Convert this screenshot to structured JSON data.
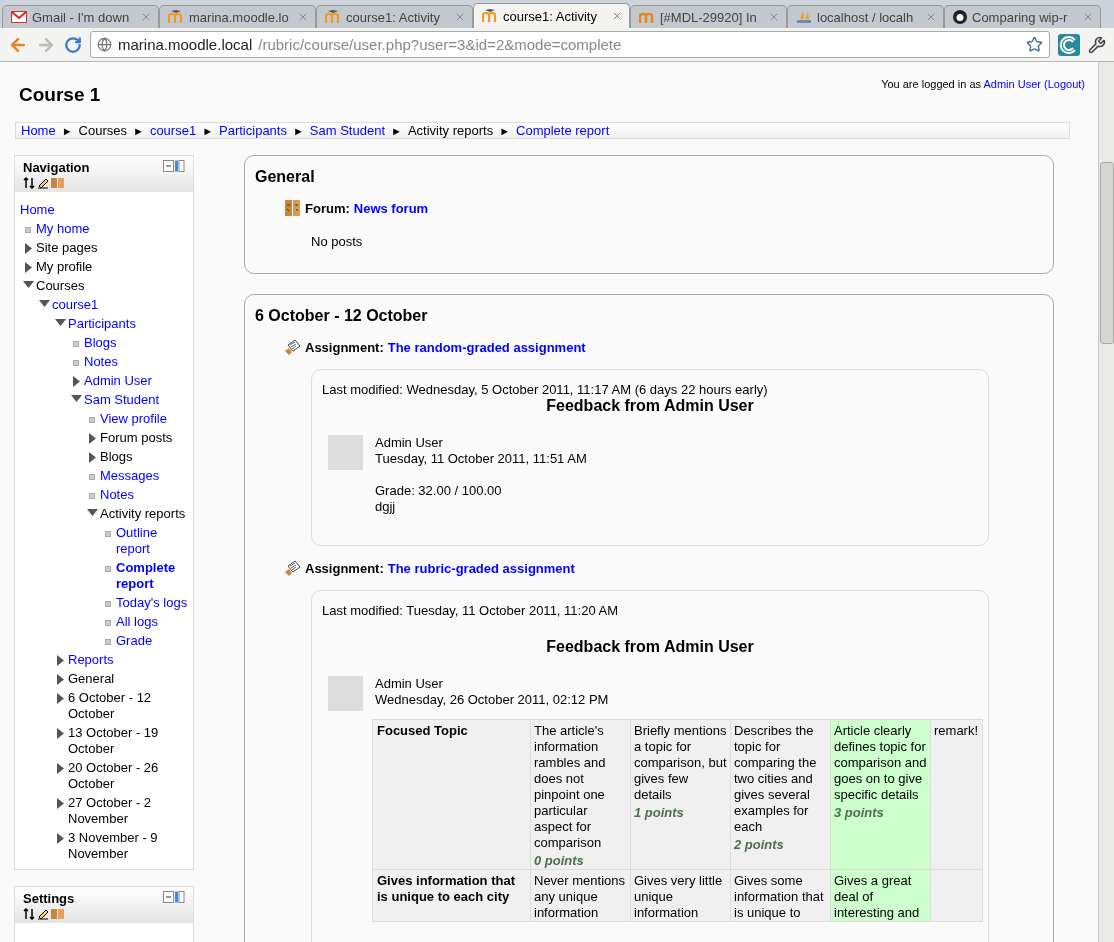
{
  "browser": {
    "tabs": [
      {
        "title": "Gmail - I'm down",
        "selected": false
      },
      {
        "title": "marina.moodle.lo",
        "selected": false
      },
      {
        "title": "course1: Activity",
        "selected": false
      },
      {
        "title": "course1: Activity",
        "selected": true
      },
      {
        "title": "[#MDL-29920] In",
        "selected": false
      },
      {
        "title": "localhost / localh",
        "selected": false
      },
      {
        "title": "Comparing wip-r",
        "selected": false
      }
    ],
    "url_host": "marina.moodle.local",
    "url_path": "/rubric/course/user.php?user=3&id=2&mode=complete"
  },
  "page": {
    "title": "Course 1",
    "login_prefix": "You are logged in as",
    "login_user": "Admin User",
    "logout": "(Logout)",
    "breadcrumb": [
      {
        "label": "Home",
        "link": true
      },
      {
        "sep": "►",
        "label": "Courses",
        "link": false
      },
      {
        "sep": "►",
        "label": "course1",
        "link": true
      },
      {
        "sep": "►",
        "label": "Participants",
        "link": true
      },
      {
        "sep": "►",
        "label": "Sam Student",
        "link": true
      },
      {
        "sep": "►",
        "label": "Activity reports",
        "link": false
      },
      {
        "sep": "►",
        "label": "Complete report",
        "link": true
      }
    ]
  },
  "navigation": {
    "title": "Navigation",
    "tree": [
      {
        "label": "Home",
        "kind": "root",
        "link": true,
        "selected": false,
        "children": [
          {
            "label": "My home",
            "kind": "leaf",
            "link": true,
            "selected": false
          },
          {
            "label": "Site pages",
            "kind": "collapsed",
            "link": false,
            "selected": false
          },
          {
            "label": "My profile",
            "kind": "collapsed",
            "link": false,
            "selected": false
          },
          {
            "label": "Courses",
            "kind": "expanded",
            "link": false,
            "selected": false,
            "children": [
              {
                "label": "course1",
                "kind": "expanded",
                "link": true,
                "selected": false,
                "children": [
                  {
                    "label": "Participants",
                    "kind": "expanded",
                    "link": true,
                    "selected": false,
                    "children": [
                      {
                        "label": "Blogs",
                        "kind": "leaf",
                        "link": true,
                        "selected": false
                      },
                      {
                        "label": "Notes",
                        "kind": "leaf",
                        "link": true,
                        "selected": false
                      },
                      {
                        "label": "Admin User",
                        "kind": "collapsed",
                        "link": true,
                        "selected": false
                      },
                      {
                        "label": "Sam Student",
                        "kind": "expanded",
                        "link": true,
                        "selected": false,
                        "children": [
                          {
                            "label": "View profile",
                            "kind": "leaf",
                            "link": true,
                            "selected": false
                          },
                          {
                            "label": "Forum posts",
                            "kind": "collapsed",
                            "link": false,
                            "selected": false
                          },
                          {
                            "label": "Blogs",
                            "kind": "collapsed",
                            "link": false,
                            "selected": false
                          },
                          {
                            "label": "Messages",
                            "kind": "leaf",
                            "link": true,
                            "selected": false
                          },
                          {
                            "label": "Notes",
                            "kind": "leaf",
                            "link": true,
                            "selected": false
                          },
                          {
                            "label": "Activity reports",
                            "kind": "expanded",
                            "link": false,
                            "selected": false,
                            "children": [
                              {
                                "label": "Outline report",
                                "kind": "leaf",
                                "link": true,
                                "selected": false
                              },
                              {
                                "label": "Complete report",
                                "kind": "leaf",
                                "link": true,
                                "selected": true
                              },
                              {
                                "label": "Today's logs",
                                "kind": "leaf",
                                "link": true,
                                "selected": false
                              },
                              {
                                "label": "All logs",
                                "kind": "leaf",
                                "link": true,
                                "selected": false
                              },
                              {
                                "label": "Grade",
                                "kind": "leaf",
                                "link": true,
                                "selected": false
                              }
                            ]
                          }
                        ]
                      }
                    ]
                  },
                  {
                    "label": "Reports",
                    "kind": "collapsed",
                    "link": true,
                    "selected": false
                  },
                  {
                    "label": "General",
                    "kind": "collapsed",
                    "link": false,
                    "selected": false
                  },
                  {
                    "label": "6 October - 12 October",
                    "kind": "collapsed",
                    "link": false,
                    "selected": false
                  },
                  {
                    "label": "13 October - 19 October",
                    "kind": "collapsed",
                    "link": false,
                    "selected": false
                  },
                  {
                    "label": "20 October - 26 October",
                    "kind": "collapsed",
                    "link": false,
                    "selected": false
                  },
                  {
                    "label": "27 October - 2 November",
                    "kind": "collapsed",
                    "link": false,
                    "selected": false
                  },
                  {
                    "label": "3 November - 9 November",
                    "kind": "collapsed",
                    "link": false,
                    "selected": false
                  }
                ]
              }
            ]
          }
        ]
      }
    ]
  },
  "settings": {
    "title": "Settings"
  },
  "sections": [
    {
      "title": "General",
      "activities": [
        {
          "kind": "forum",
          "type_label": "Forum:",
          "name": "News forum",
          "body": "No posts"
        }
      ]
    },
    {
      "title": "6 October - 12 October",
      "activities": [
        {
          "kind": "assignment",
          "type_label": "Assignment:",
          "name": "The random-graded assignment",
          "modified": "Last modified: Wednesday, 5 October 2011, 11:17 AM (6 days 22 hours early)",
          "feedback_title": "Feedback from Admin User",
          "author": "Admin User",
          "date": "Tuesday, 11 October 2011, 11:51 AM",
          "grade": "Grade: 32.00 / 100.00",
          "comment": "dgjj"
        },
        {
          "kind": "assignment",
          "type_label": "Assignment:",
          "name": "The rubric-graded assignment",
          "modified": "Last modified: Tuesday, 11 October 2011, 11:20 AM",
          "feedback_title": "Feedback from Admin User",
          "author": "Admin User",
          "date": "Wednesday, 26 October 2011, 02:12 PM",
          "rubric": [
            {
              "criterion": "Focused Topic",
              "remark": "remark!",
              "levels": [
                {
                  "text": "The article's information rambles and does not pinpoint one particular aspect for comparison",
                  "points": "0 points",
                  "selected": false
                },
                {
                  "text": "Briefly mentions a topic for comparison, but gives few details",
                  "points": "1 points",
                  "selected": false
                },
                {
                  "text": "Describes the topic for comparing the two cities and gives several examples for each",
                  "points": "2 points",
                  "selected": false
                },
                {
                  "text": "Article clearly defines topic for comparison and goes on to give specific details",
                  "points": "3 points",
                  "selected": true
                }
              ]
            },
            {
              "criterion": "Gives information that is unique to each city",
              "levels": [
                {
                  "text": "Never mentions any unique information",
                  "selected": false
                },
                {
                  "text": "Gives very little unique information",
                  "selected": false
                },
                {
                  "text": "Gives some information that is unique to",
                  "selected": false
                },
                {
                  "text": "Gives a great deal of interesting and",
                  "selected": true
                }
              ]
            }
          ]
        }
      ]
    }
  ]
}
